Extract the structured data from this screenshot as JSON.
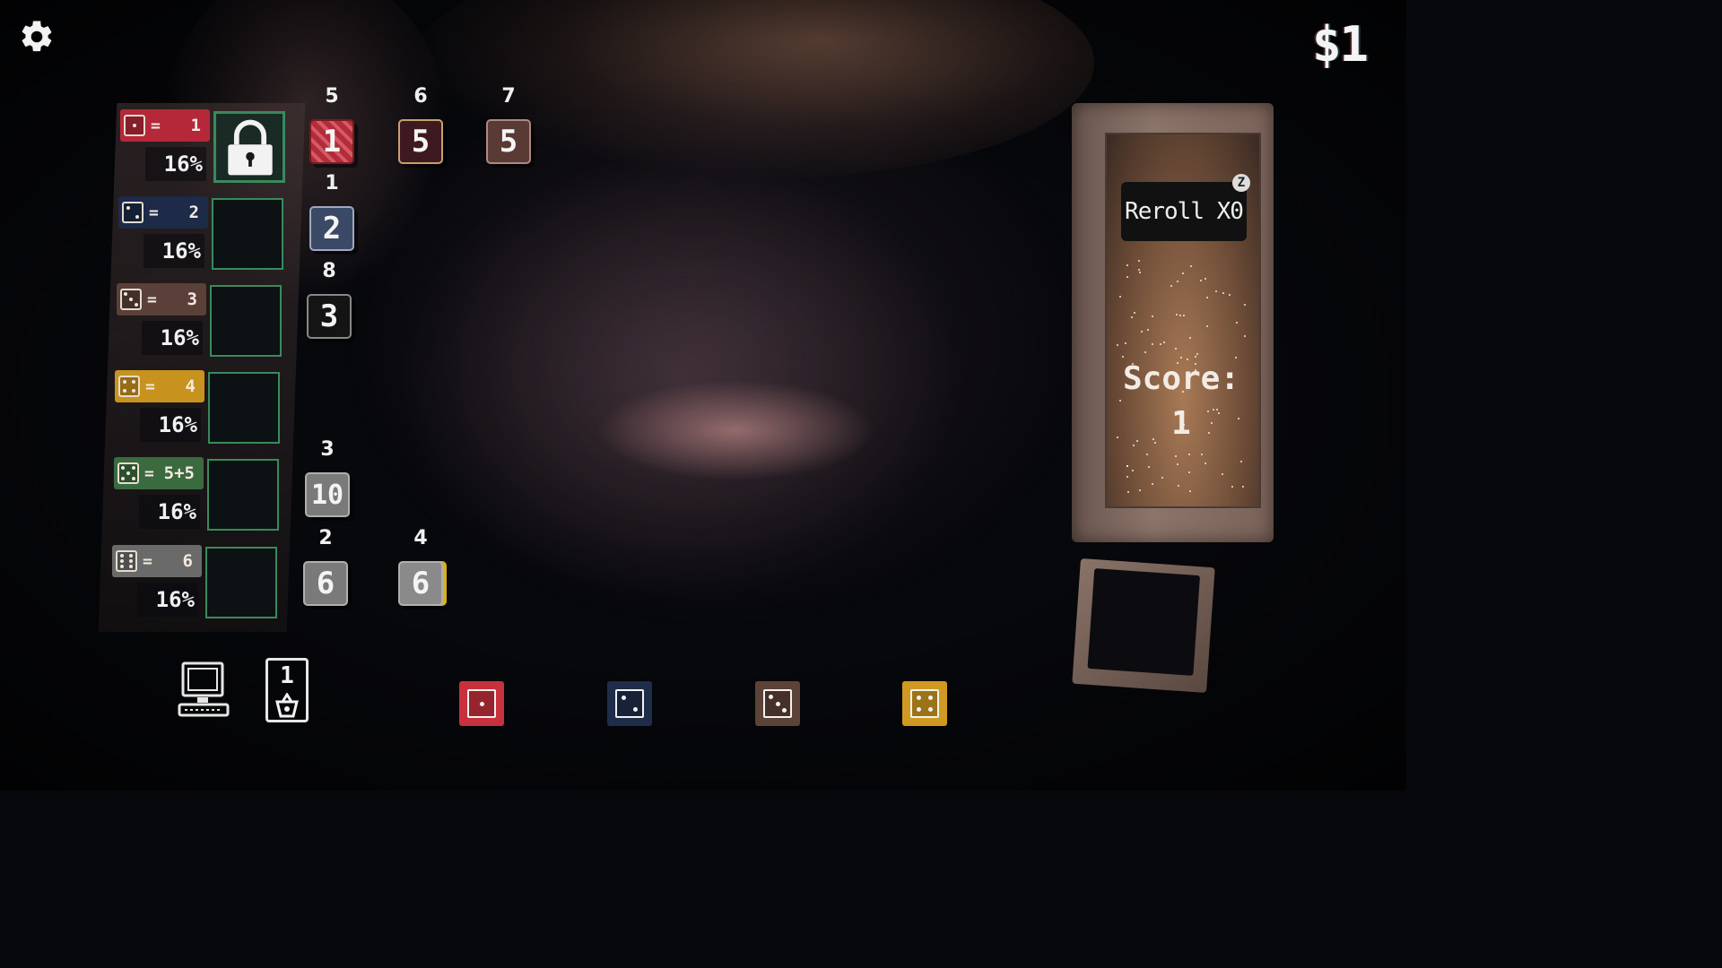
{
  "hud": {
    "settings_icon": "gear-icon",
    "money": "$1"
  },
  "categories": [
    {
      "face": 1,
      "equals": "=",
      "value": "1",
      "chance": "16%",
      "color": "#b4283a",
      "slot_state": "locked"
    },
    {
      "face": 2,
      "equals": "=",
      "value": "2",
      "chance": "16%",
      "color": "#1d2a48",
      "slot_state": "empty"
    },
    {
      "face": 3,
      "equals": "=",
      "value": "3",
      "chance": "16%",
      "color": "#5a4038",
      "slot_state": "empty"
    },
    {
      "face": 4,
      "equals": "=",
      "value": "4",
      "chance": "16%",
      "color": "#c8921e",
      "slot_state": "empty"
    },
    {
      "face": 5,
      "equals": "=",
      "value": "5+5",
      "chance": "16%",
      "color": "#3a6a3e",
      "slot_state": "empty"
    },
    {
      "face": 6,
      "equals": "=",
      "value": "6",
      "chance": "16%",
      "color": "#6a6a6a",
      "slot_state": "empty"
    }
  ],
  "dice": [
    {
      "row": 1,
      "col": 1,
      "label": "5",
      "face_value": "1",
      "style": "red-striped"
    },
    {
      "row": 1,
      "col": 2,
      "label": "6",
      "face_value": "5",
      "style": "dark-red"
    },
    {
      "row": 1,
      "col": 3,
      "label": "7",
      "face_value": "5",
      "style": "brown-circuit"
    },
    {
      "row": 2,
      "col": 1,
      "label": "1",
      "face_value": "2",
      "style": "slate-blue"
    },
    {
      "row": 3,
      "col": 1,
      "label": "8",
      "face_value": "3",
      "style": "black"
    },
    {
      "row": 5,
      "col": 1,
      "label": "3",
      "face_value": "10",
      "style": "grey"
    },
    {
      "row": 6,
      "col": 1,
      "label": "2",
      "face_value": "6",
      "style": "grey"
    },
    {
      "row": 6,
      "col": 2,
      "label": "4",
      "face_value": "6",
      "style": "grey-yellow"
    }
  ],
  "machine": {
    "reroll_label": "Reroll X0",
    "reroll_hotkey": "Z",
    "score_label": "Score:",
    "score_value": "1"
  },
  "bottom_bar": {
    "computer_icon": "computer-icon",
    "card": {
      "number": "1",
      "icon": "basket-icon"
    },
    "tray_dice": [
      {
        "face": 1,
        "color": "#c8303e"
      },
      {
        "face": 2,
        "color": "#1f2c4a"
      },
      {
        "face": 3,
        "color": "#5d4238"
      },
      {
        "face": 4,
        "color": "#d09a22"
      }
    ]
  }
}
